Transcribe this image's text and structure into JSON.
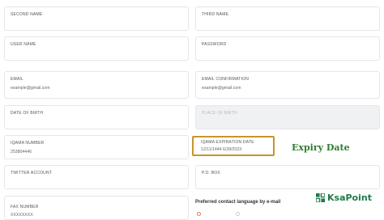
{
  "form": {
    "second_name": {
      "label": "SECOND NAME",
      "value": ""
    },
    "third_name": {
      "label": "THIRD NAME",
      "value": ""
    },
    "user_name": {
      "label": "USER NAME",
      "value": ""
    },
    "password": {
      "label": "PASSWORD",
      "value": ""
    },
    "email": {
      "label": "EMAIL",
      "value": "example@gmail.com"
    },
    "email_confirmation": {
      "label": "EMAIL CONFIRMATION",
      "value": "example@gmail.com"
    },
    "date_of_birth": {
      "label": "DATE OF BIRTH",
      "value": ""
    },
    "place_of_birth": {
      "label": "PLACE OF BIRTH",
      "value": ""
    },
    "iqama_number": {
      "label": "IQAMA NUMBER",
      "value": "253804446"
    },
    "iqama_expiration": {
      "label": "IQAMA EXPIRATION DATE",
      "value": "12/11/1444 6/28/2023"
    },
    "twitter": {
      "label": "TWITTER ACCOUNT",
      "value": ""
    },
    "po_box": {
      "label": "P.O. BOX",
      "value": ""
    },
    "fax": {
      "label": "FAX NUMBER",
      "value": "XXXXXXXX"
    },
    "preferred_language": "Preferred contact language by e-mail"
  },
  "annotation": {
    "callout": "Expiry Date",
    "color": "#c8952b"
  },
  "logo": {
    "text": "KsaPoint"
  }
}
